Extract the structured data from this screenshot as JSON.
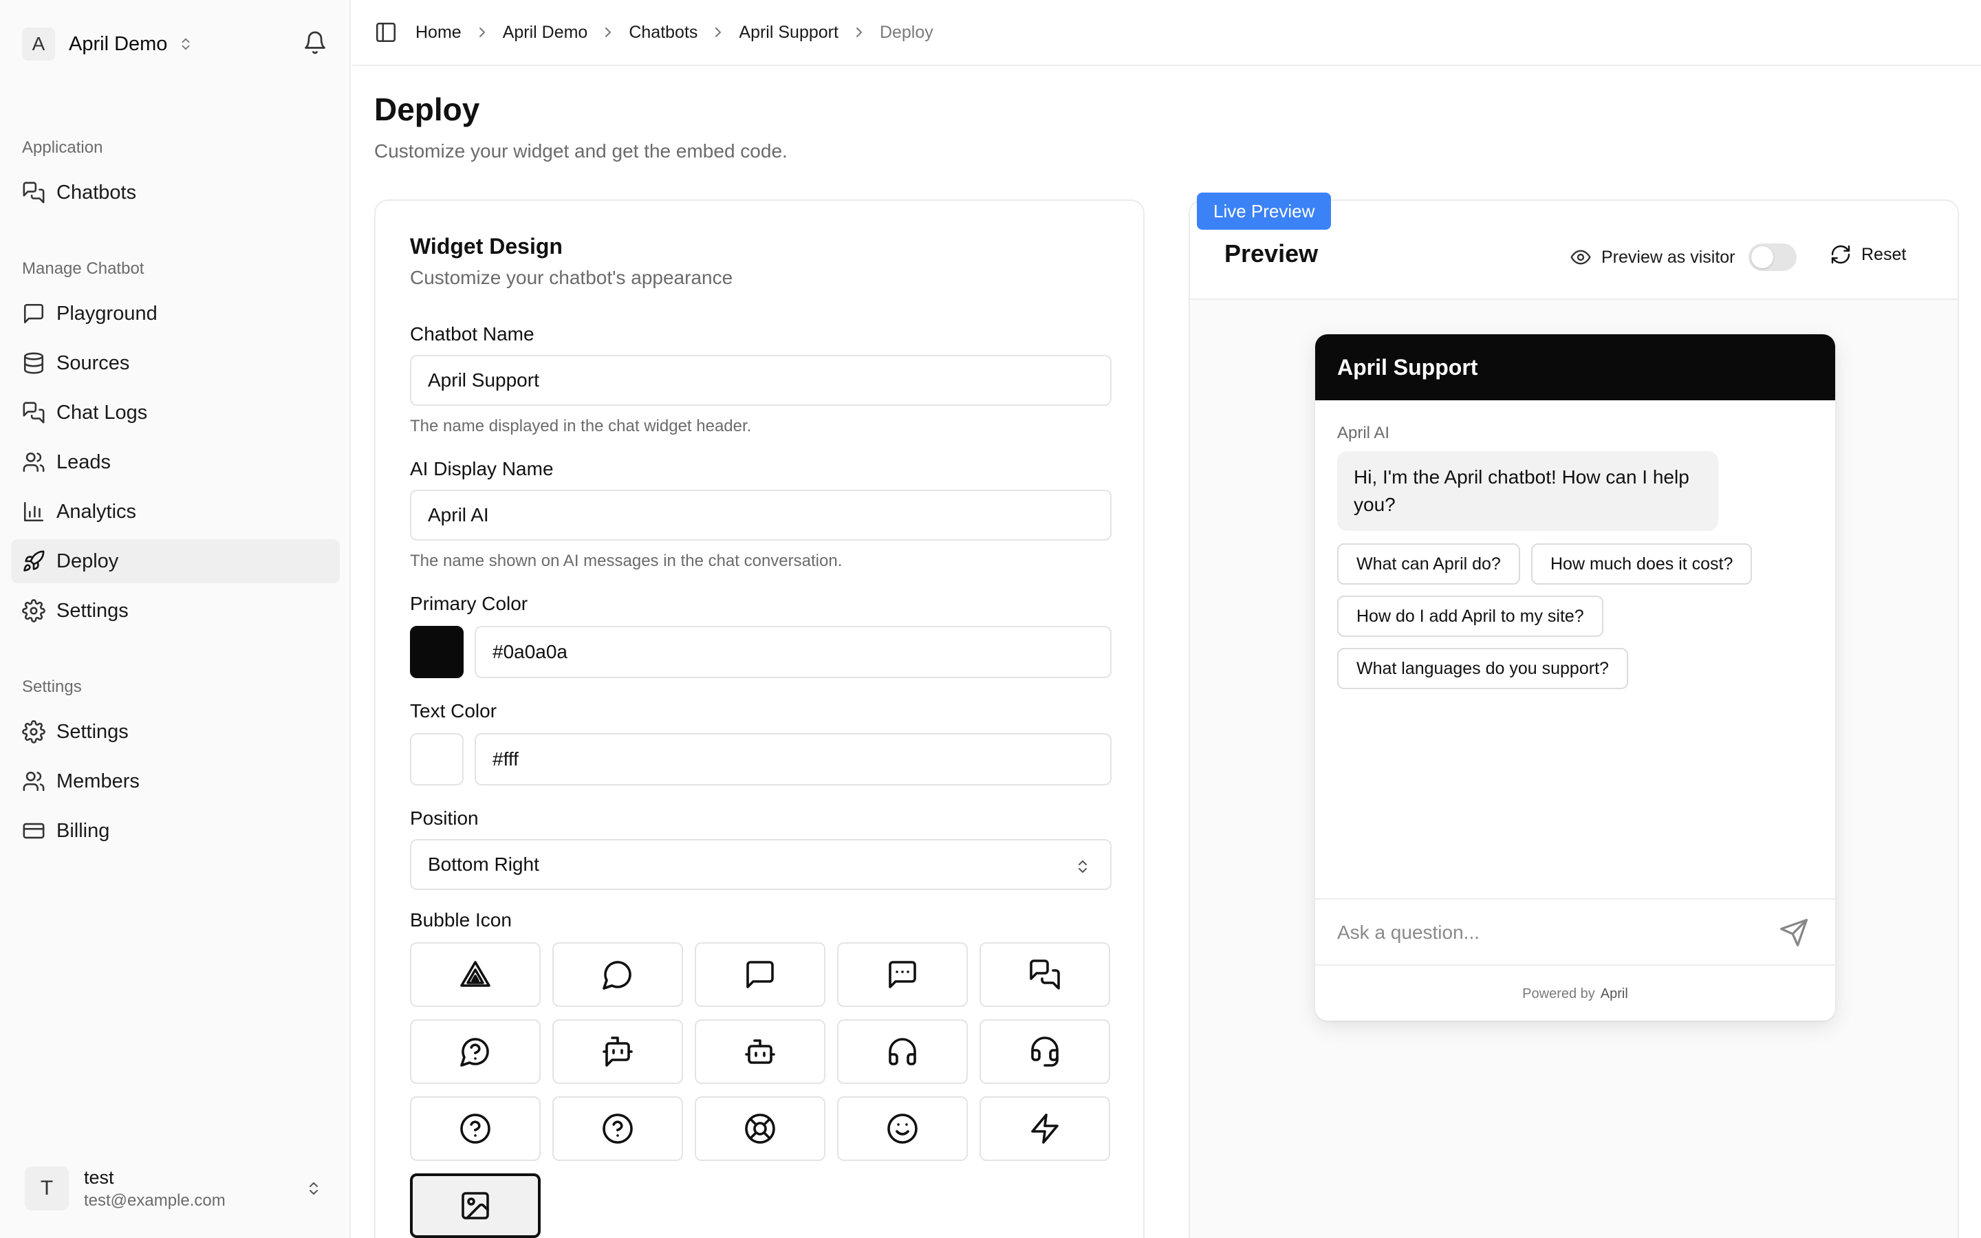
{
  "sidebar": {
    "org_initial": "A",
    "org_name": "April Demo",
    "groups": {
      "application": "Application",
      "manage": "Manage Chatbot",
      "settings": "Settings"
    },
    "items": {
      "chatbots": "Chatbots",
      "playground": "Playground",
      "sources": "Sources",
      "chat_logs": "Chat Logs",
      "leads": "Leads",
      "analytics": "Analytics",
      "deploy": "Deploy",
      "chatbot_settings": "Settings",
      "settings": "Settings",
      "members": "Members",
      "billing": "Billing"
    },
    "active_item": "Deploy",
    "user": {
      "initial": "T",
      "name": "test",
      "email": "test@example.com"
    }
  },
  "breadcrumb": {
    "home": "Home",
    "org": "April Demo",
    "chatbots": "Chatbots",
    "chatbot": "April Support",
    "current": "Deploy"
  },
  "page": {
    "title": "Deploy",
    "subtitle": "Customize your widget and get the embed code."
  },
  "widget_design": {
    "title": "Widget Design",
    "subtitle": "Customize your chatbot's appearance",
    "chatbot_name_label": "Chatbot Name",
    "chatbot_name_value": "April Support",
    "chatbot_name_hint": "The name displayed in the chat widget header.",
    "ai_name_label": "AI Display Name",
    "ai_name_value": "April AI",
    "ai_name_hint": "The name shown on AI messages in the chat conversation.",
    "primary_color_label": "Primary Color",
    "primary_color_value": "#0a0a0a",
    "text_color_label": "Text Color",
    "text_color_value": "#fff",
    "position_label": "Position",
    "position_value": "Bottom Right",
    "bubble_icon_label": "Bubble Icon",
    "bubble_icons": [
      "april-logo-icon",
      "message-circle-icon",
      "message-square-icon",
      "message-square-more-icon",
      "messages-square-icon",
      "message-circle-question-icon",
      "bot-message-square-icon",
      "bot-icon",
      "headphones-icon",
      "headset-icon",
      "circle-help-icon",
      "circle-question-icon",
      "life-buoy-icon",
      "smile-icon",
      "zap-icon",
      "image-icon"
    ],
    "selected_icon": "image-icon"
  },
  "preview": {
    "badge": "Live Preview",
    "title": "Preview",
    "visitor_label": "Preview as visitor",
    "visitor_toggle_on": false,
    "reset_label": "Reset",
    "chat": {
      "header": "April Support",
      "ai_name": "April AI",
      "greeting": "Hi, I'm the April chatbot! How can I help you?",
      "suggestions": [
        "What can April do?",
        "How much does it cost?",
        "How do I add April to my site?",
        "What languages do you support?"
      ],
      "input_placeholder": "Ask a question...",
      "powered_prefix": "Powered by",
      "powered_brand": "April"
    }
  },
  "colors": {
    "accent": "#3b82f6",
    "primary": "#0a0a0a",
    "text": "#ffffff"
  }
}
